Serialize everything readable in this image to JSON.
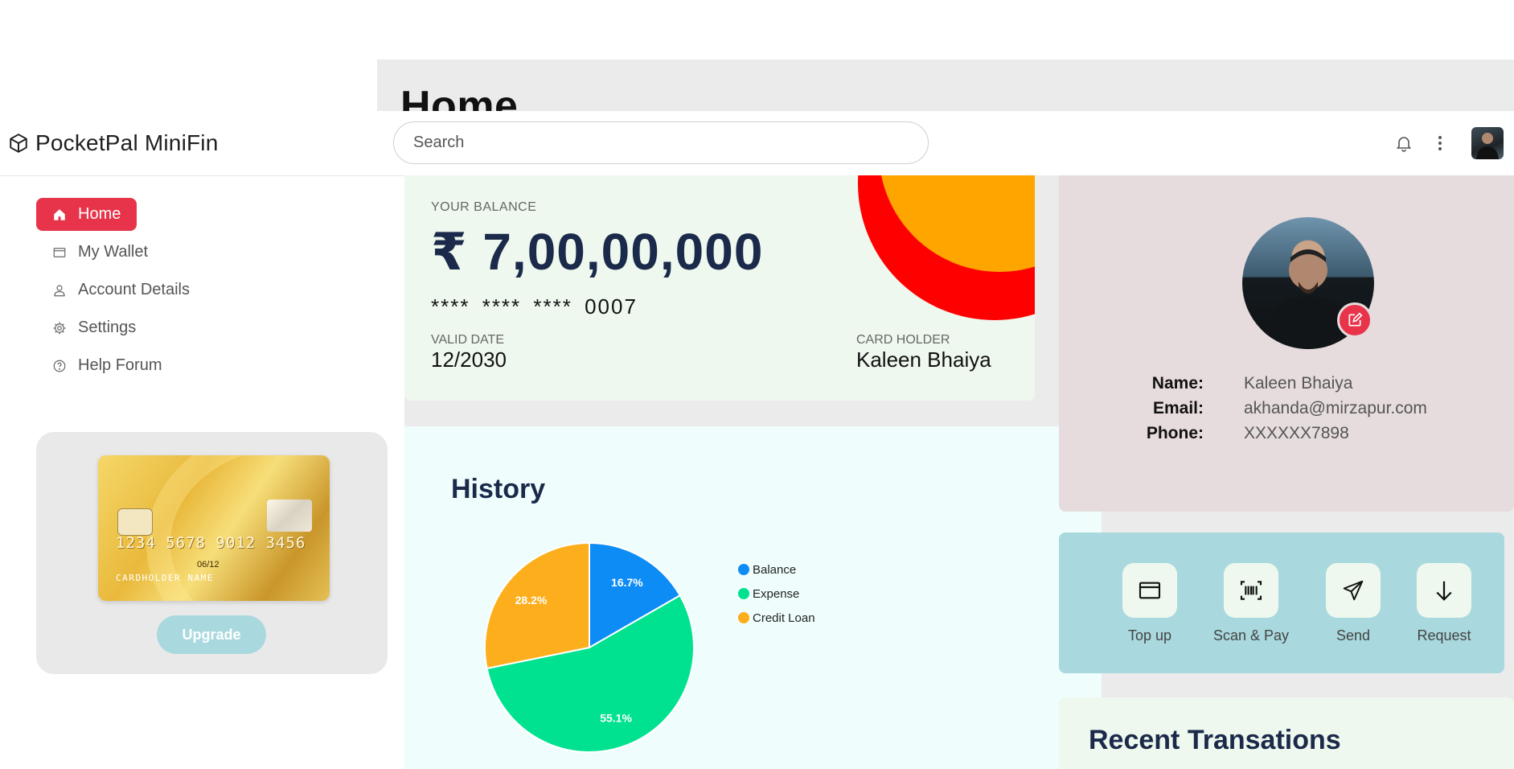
{
  "page": {
    "title": "Home"
  },
  "header": {
    "brand": "PocketPal MiniFin",
    "search_placeholder": "Search"
  },
  "sidebar": {
    "items": [
      {
        "label": "Home",
        "icon": "home-icon",
        "active": true
      },
      {
        "label": "My Wallet",
        "icon": "wallet-icon",
        "active": false
      },
      {
        "label": "Account Details",
        "icon": "user-icon",
        "active": false
      },
      {
        "label": "Settings",
        "icon": "gear-icon",
        "active": false
      },
      {
        "label": "Help Forum",
        "icon": "help-icon",
        "active": false
      }
    ],
    "promo_card": {
      "number": "1234 5678 9012 3456",
      "expiry": "06/12",
      "holder": "CARDHOLDER NAME"
    },
    "upgrade_label": "Upgrade"
  },
  "balance": {
    "label": "YOUR BALANCE",
    "amount": "₹ 7,00,00,000",
    "card_number": "**** **** **** 0007",
    "valid_label": "VALID DATE",
    "valid_value": "12/2030",
    "holder_label": "CARD HOLDER",
    "holder_value": "Kaleen Bhaiya"
  },
  "history": {
    "title": "History",
    "chart_data": {
      "type": "pie",
      "categories": [
        "Balance",
        "Expense",
        "Credit Loan"
      ],
      "values": [
        16.7,
        55.1,
        28.2
      ],
      "labels": [
        "16.7%",
        "55.1%",
        "28.2%"
      ],
      "colors": [
        "#0d8cf5",
        "#00e28f",
        "#fdae1c"
      ],
      "legend_position": "right"
    }
  },
  "profile": {
    "rows": [
      {
        "key": "Name:",
        "value": "Kaleen Bhaiya"
      },
      {
        "key": "Email:",
        "value": "akhanda@mirzapur.com"
      },
      {
        "key": "Phone:",
        "value": "XXXXXX7898"
      }
    ]
  },
  "actions": [
    {
      "label": "Top up",
      "icon": "wallet-icon"
    },
    {
      "label": "Scan & Pay",
      "icon": "barcode-icon"
    },
    {
      "label": "Send",
      "icon": "send-icon"
    },
    {
      "label": "Request",
      "icon": "arrow-down-icon"
    }
  ],
  "recent": {
    "title": "Recent Transations"
  },
  "colors": {
    "accent_red": "#e8344a",
    "navy": "#1b2a4a",
    "teal": "#a9d9de"
  }
}
